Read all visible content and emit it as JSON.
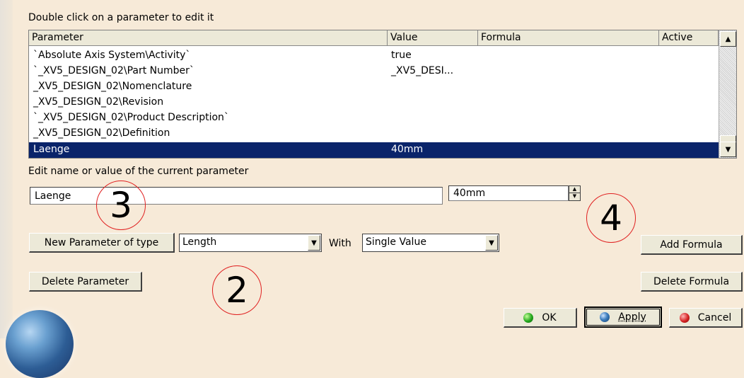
{
  "instruction": "Double click on a parameter to edit it",
  "table": {
    "headers": [
      "Parameter",
      "Value",
      "Formula",
      "Active"
    ],
    "rows": [
      {
        "parameter": "`Absolute Axis System\\Activity`",
        "value": "true"
      },
      {
        "parameter": "`_XV5_DESIGN_02\\Part Number`",
        "value": "_XV5_DESI..."
      },
      {
        "parameter": "_XV5_DESIGN_02\\Nomenclature",
        "value": ""
      },
      {
        "parameter": "_XV5_DESIGN_02\\Revision",
        "value": ""
      },
      {
        "parameter": "`_XV5_DESIGN_02\\Product Description`",
        "value": ""
      },
      {
        "parameter": "_XV5_DESIGN_02\\Definition",
        "value": ""
      },
      {
        "parameter": "Laenge",
        "value": "40mm"
      }
    ],
    "selected_row": 6
  },
  "edit_label": "Edit name or value of the current parameter",
  "name_field": {
    "value": "Laenge"
  },
  "value_field": {
    "value": "40mm"
  },
  "new_param": {
    "button_label": "New Parameter of type",
    "type_value": "Length",
    "with_label": "With",
    "with_value": "Single Value"
  },
  "buttons": {
    "delete_parameter": "Delete Parameter",
    "add_formula": "Add Formula",
    "delete_formula": "Delete Formula",
    "ok": "OK",
    "apply": "Apply",
    "cancel": "Cancel"
  },
  "annotations": {
    "circle3": "3",
    "circle4": "4",
    "circle2": "2"
  },
  "icons": {
    "scroll_up": "▲",
    "scroll_down": "▼",
    "dropdown": "▼",
    "spin_up": "▲",
    "spin_down": "▼"
  }
}
